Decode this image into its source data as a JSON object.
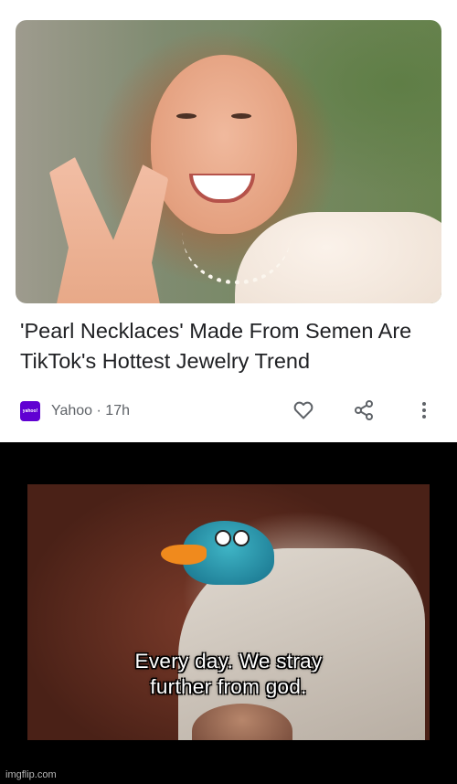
{
  "article": {
    "headline": "'Pearl Necklaces' Made From Semen Are TikTok's Hottest Jewelry Trend",
    "source_logo_text": "yahoo!",
    "source": "Yahoo",
    "age": "· 17h",
    "actions": [
      "heart-icon",
      "share-icon",
      "more-vert-icon"
    ],
    "brand_color": "#6001d2"
  },
  "meme": {
    "caption_line1": "Every day. We stray",
    "caption_line2": "further from god."
  },
  "watermark": "imgflip.com"
}
